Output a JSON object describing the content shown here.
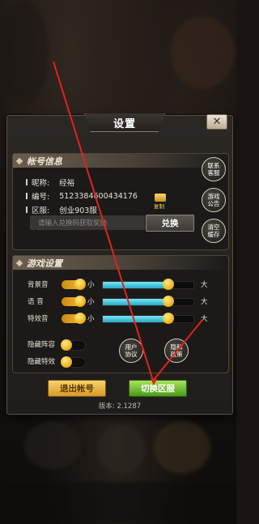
{
  "dialog": {
    "title": "设置",
    "close_label": "✕"
  },
  "account": {
    "section_title": "帐号信息",
    "nickname_label": "昵称:",
    "nickname_value": "经裕",
    "id_label": "编号:",
    "id_value": "5123384600434176",
    "copy_label": "复制",
    "server_label": "区服:",
    "server_value": "创业903服",
    "redeem_placeholder": "请输入兑换码获取奖励",
    "redeem_button": "兑换",
    "side_buttons": [
      "联系\n客服",
      "游戏\n公告",
      "清空\n缓存"
    ]
  },
  "game_settings": {
    "section_title": "游戏设置",
    "sliders": [
      {
        "label": "背景音",
        "min_label": "小",
        "max_label": "大",
        "level_percent": 72,
        "enabled": true
      },
      {
        "label": "语  音",
        "min_label": "小",
        "max_label": "大",
        "level_percent": 72,
        "enabled": true
      },
      {
        "label": "特效音",
        "min_label": "小",
        "max_label": "大",
        "level_percent": 72,
        "enabled": true
      }
    ],
    "toggles": [
      {
        "label": "隐藏阵容",
        "enabled": false
      },
      {
        "label": "隐藏特效",
        "enabled": false
      }
    ],
    "agreement_button": "用户\n协议",
    "privacy_button": "隐私\n政策"
  },
  "footer": {
    "logout_button": "退出帐号",
    "switch_server_button": "切换区服",
    "version": "版本: 2.1287"
  },
  "colors": {
    "annotation_arrow": "#e0231c",
    "switch_button": "#6cb82a",
    "logout_button": "#e6b23c",
    "slider_fill": "#3cc4dc"
  }
}
